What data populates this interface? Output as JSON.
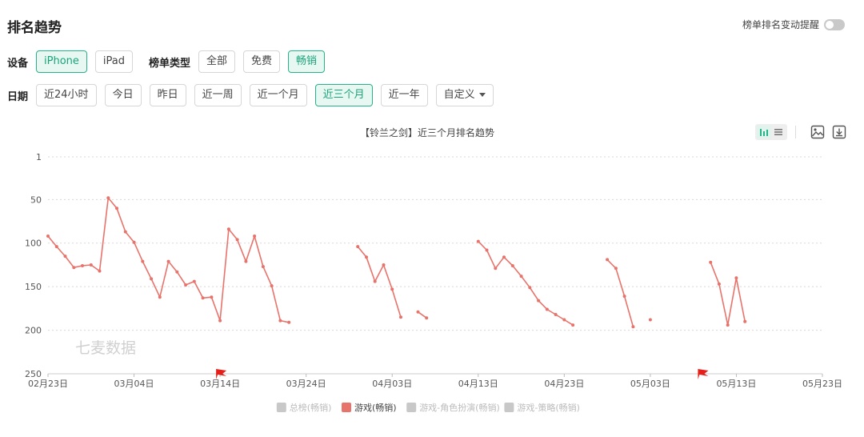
{
  "header": {
    "title": "排名趋势",
    "alert_label": "榜单排名变动提醒"
  },
  "filters": {
    "device_label": "设备",
    "devices": [
      {
        "label": "iPhone",
        "active": true
      },
      {
        "label": "iPad",
        "active": false
      }
    ],
    "type_label": "榜单类型",
    "types": [
      {
        "label": "全部",
        "active": false
      },
      {
        "label": "免费",
        "active": false
      },
      {
        "label": "畅销",
        "active": true
      }
    ],
    "date_label": "日期",
    "dates": [
      {
        "label": "近24小时",
        "active": false
      },
      {
        "label": "今日",
        "active": false
      },
      {
        "label": "昨日",
        "active": false
      },
      {
        "label": "近一周",
        "active": false
      },
      {
        "label": "近一个月",
        "active": false
      },
      {
        "label": "近三个月",
        "active": true
      },
      {
        "label": "近一年",
        "active": false
      }
    ],
    "custom_label": "自定义"
  },
  "colors": {
    "accent": "#27b38a",
    "series_active": "#e8736b",
    "series_inactive": "#c8c8c8"
  },
  "icons": {
    "bar_view": "bar-chart-icon",
    "list_view": "list-icon",
    "image": "image-icon",
    "download": "download-icon"
  },
  "watermark": "七麦数据",
  "chart_data": {
    "type": "line",
    "title": "【铃兰之剑】近三个月排名趋势",
    "y_inverted": true,
    "ylim": [
      1,
      250
    ],
    "y_ticks": [
      "1",
      "50",
      "100",
      "150",
      "200",
      "250"
    ],
    "x_range": [
      "2024-02-23",
      "2024-05-23"
    ],
    "x_ticks": [
      {
        "date": "2024-02-23",
        "label": "02月23日"
      },
      {
        "date": "2024-03-04",
        "label": "03月04日"
      },
      {
        "date": "2024-03-14",
        "label": "03月14日"
      },
      {
        "date": "2024-03-24",
        "label": "03月24日"
      },
      {
        "date": "2024-04-03",
        "label": "04月03日"
      },
      {
        "date": "2024-04-13",
        "label": "04月13日"
      },
      {
        "date": "2024-04-23",
        "label": "04月23日"
      },
      {
        "date": "2024-05-03",
        "label": "05月03日"
      },
      {
        "date": "2024-05-13",
        "label": "05月13日"
      },
      {
        "date": "2024-05-23",
        "label": "05月23日"
      }
    ],
    "flags": [
      "2024-03-14",
      "2024-05-09"
    ],
    "grid": "horizontal-dotted",
    "legend_position": "bottom",
    "legend": [
      {
        "name": "总榜(畅销)",
        "active": false
      },
      {
        "name": "游戏(畅销)",
        "active": true
      },
      {
        "name": "游戏-角色扮演(畅销)",
        "active": false
      },
      {
        "name": "游戏-策略(畅销)",
        "active": false
      }
    ],
    "series": [
      {
        "name": "游戏(畅销)",
        "segments": [
          [
            {
              "x": "2024-02-23",
              "y": 92
            },
            {
              "x": "2024-02-24",
              "y": 104
            },
            {
              "x": "2024-02-25",
              "y": 115
            },
            {
              "x": "2024-02-26",
              "y": 128
            },
            {
              "x": "2024-02-27",
              "y": 126
            },
            {
              "x": "2024-02-28",
              "y": 125
            },
            {
              "x": "2024-02-29",
              "y": 132
            },
            {
              "x": "2024-03-01",
              "y": 48
            },
            {
              "x": "2024-03-02",
              "y": 60
            },
            {
              "x": "2024-03-03",
              "y": 87
            },
            {
              "x": "2024-03-04",
              "y": 99
            },
            {
              "x": "2024-03-05",
              "y": 121
            },
            {
              "x": "2024-03-06",
              "y": 141
            },
            {
              "x": "2024-03-07",
              "y": 162
            },
            {
              "x": "2024-03-08",
              "y": 121
            },
            {
              "x": "2024-03-09",
              "y": 133
            },
            {
              "x": "2024-03-10",
              "y": 148
            },
            {
              "x": "2024-03-11",
              "y": 144
            },
            {
              "x": "2024-03-12",
              "y": 163
            },
            {
              "x": "2024-03-13",
              "y": 162
            },
            {
              "x": "2024-03-14",
              "y": 189
            },
            {
              "x": "2024-03-15",
              "y": 84
            },
            {
              "x": "2024-03-16",
              "y": 96
            },
            {
              "x": "2024-03-17",
              "y": 121
            },
            {
              "x": "2024-03-18",
              "y": 92
            },
            {
              "x": "2024-03-19",
              "y": 127
            },
            {
              "x": "2024-03-20",
              "y": 149
            },
            {
              "x": "2024-03-21",
              "y": 189
            },
            {
              "x": "2024-03-22",
              "y": 191
            }
          ],
          [
            {
              "x": "2024-03-30",
              "y": 104
            },
            {
              "x": "2024-03-31",
              "y": 116
            },
            {
              "x": "2024-04-01",
              "y": 144
            },
            {
              "x": "2024-04-02",
              "y": 125
            },
            {
              "x": "2024-04-03",
              "y": 153
            },
            {
              "x": "2024-04-04",
              "y": 185
            }
          ],
          [
            {
              "x": "2024-04-06",
              "y": 179
            },
            {
              "x": "2024-04-07",
              "y": 186
            }
          ],
          [
            {
              "x": "2024-04-13",
              "y": 98
            },
            {
              "x": "2024-04-14",
              "y": 108
            },
            {
              "x": "2024-04-15",
              "y": 129
            },
            {
              "x": "2024-04-16",
              "y": 116
            },
            {
              "x": "2024-04-17",
              "y": 126
            },
            {
              "x": "2024-04-18",
              "y": 138
            },
            {
              "x": "2024-04-19",
              "y": 151
            },
            {
              "x": "2024-04-20",
              "y": 166
            },
            {
              "x": "2024-04-21",
              "y": 176
            },
            {
              "x": "2024-04-22",
              "y": 182
            },
            {
              "x": "2024-04-23",
              "y": 188
            },
            {
              "x": "2024-04-24",
              "y": 194
            }
          ],
          [
            {
              "x": "2024-04-28",
              "y": 119
            },
            {
              "x": "2024-04-29",
              "y": 129
            },
            {
              "x": "2024-04-30",
              "y": 161
            },
            {
              "x": "2024-05-01",
              "y": 196
            }
          ],
          [
            {
              "x": "2024-05-03",
              "y": 188
            }
          ],
          [
            {
              "x": "2024-05-10",
              "y": 122
            },
            {
              "x": "2024-05-11",
              "y": 147
            },
            {
              "x": "2024-05-12",
              "y": 194
            },
            {
              "x": "2024-05-13",
              "y": 140
            },
            {
              "x": "2024-05-14",
              "y": 190
            }
          ]
        ]
      }
    ]
  }
}
